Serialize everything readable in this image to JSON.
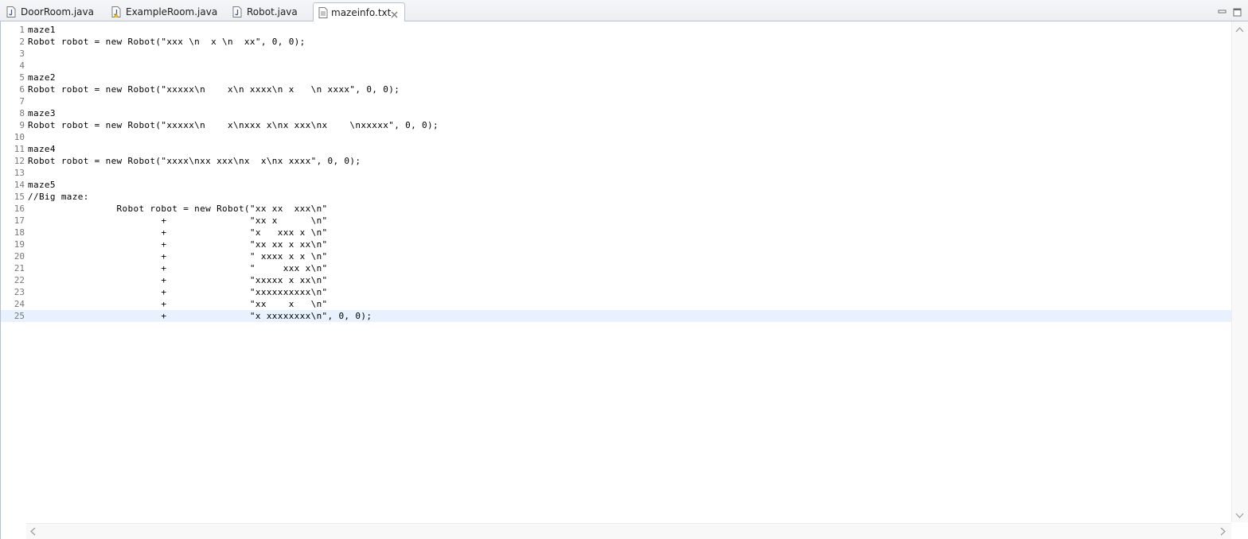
{
  "tabs": [
    {
      "label": "DoorRoom.java",
      "icon": "java-file-icon"
    },
    {
      "label": "ExampleRoom.java",
      "icon": "java-file-warning-icon"
    },
    {
      "label": "Robot.java",
      "icon": "java-file-icon"
    },
    {
      "label": "mazeinfo.txt",
      "icon": "text-file-icon",
      "active": true
    }
  ],
  "editor": {
    "file": "mazeinfo.txt",
    "current_line": 25,
    "lines": [
      {
        "n": "1",
        "text": "maze1"
      },
      {
        "n": "2",
        "text": "Robot robot = new Robot(\"xxx \\n  x \\n  xx\", 0, 0);"
      },
      {
        "n": "3",
        "text": ""
      },
      {
        "n": "4",
        "text": ""
      },
      {
        "n": "5",
        "text": "maze2"
      },
      {
        "n": "6",
        "text": "Robot robot = new Robot(\"xxxxx\\n    x\\n xxxx\\n x   \\n xxxx\", 0, 0);"
      },
      {
        "n": "7",
        "text": ""
      },
      {
        "n": "8",
        "text": "maze3"
      },
      {
        "n": "9",
        "text": "Robot robot = new Robot(\"xxxxx\\n    x\\nxxx x\\nx xxx\\nx    \\nxxxxx\", 0, 0);"
      },
      {
        "n": "10",
        "text": ""
      },
      {
        "n": "11",
        "text": "maze4"
      },
      {
        "n": "12",
        "text": "Robot robot = new Robot(\"xxxx\\nxx xxx\\nx  x\\nx xxxx\", 0, 0);"
      },
      {
        "n": "13",
        "text": ""
      },
      {
        "n": "14",
        "text": "maze5"
      },
      {
        "n": "15",
        "text": "//Big maze:"
      },
      {
        "n": "16",
        "text": "                Robot robot = new Robot(\"xx xx  xxx\\n\""
      },
      {
        "n": "17",
        "text": "                        +               \"xx x      \\n\""
      },
      {
        "n": "18",
        "text": "                        +               \"x   xxx x \\n\""
      },
      {
        "n": "19",
        "text": "                        +               \"xx xx x xx\\n\""
      },
      {
        "n": "20",
        "text": "                        +               \" xxxx x x \\n\""
      },
      {
        "n": "21",
        "text": "                        +               \"     xxx x\\n\""
      },
      {
        "n": "22",
        "text": "                        +               \"xxxxx x xx\\n\""
      },
      {
        "n": "23",
        "text": "                        +               \"xxxxxxxxxx\\n\""
      },
      {
        "n": "24",
        "text": "                        +               \"xx    x   \\n\""
      },
      {
        "n": "25",
        "text": "                        +               \"x xxxxxxxx\\n\", 0, 0);"
      }
    ]
  },
  "colors": {
    "tab_border": "#b7c2d0",
    "current_line_bg": "#e8f2fe",
    "line_number": "#787878"
  }
}
